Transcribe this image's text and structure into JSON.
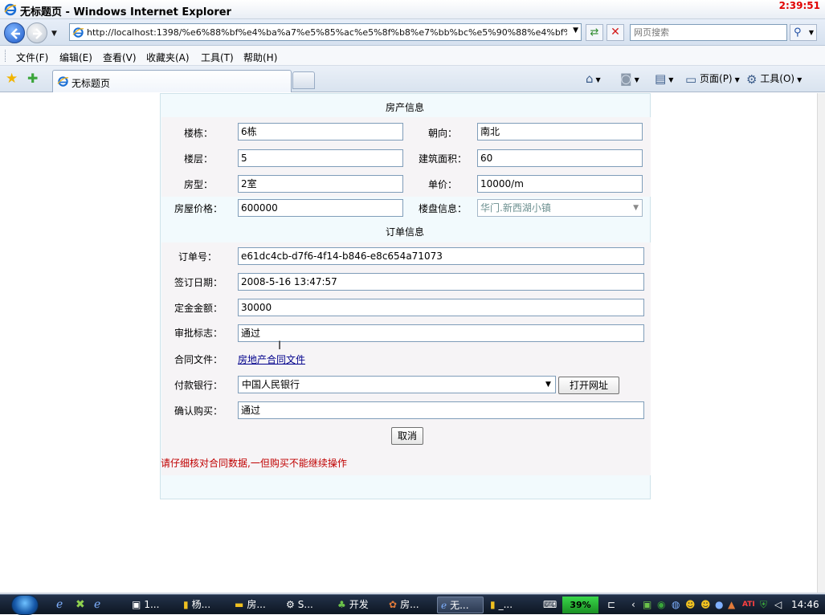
{
  "window": {
    "title": "无标题页 - Windows Internet Explorer",
    "overlay_time": "2:39:51"
  },
  "nav": {
    "address": "http://localhost:1398/%e6%88%bf%e4%ba%a7%e5%85%ac%e5%8f%b8%e7%bb%bc%e5%90%88%e4%bf%a1%e",
    "search_placeholder": "网页搜索"
  },
  "menu": [
    "文件(F)",
    "编辑(E)",
    "查看(V)",
    "收藏夹(A)",
    "工具(T)",
    "帮助(H)"
  ],
  "tab": {
    "label": "无标题页"
  },
  "commands": {
    "page": "页面(P)",
    "tools": "工具(O)"
  },
  "form": {
    "property_section": "房产信息",
    "order_section": "订单信息",
    "building_label": "楼栋：",
    "building_value": "6栋",
    "orientation_label": "朝向：",
    "orientation_value": "南北",
    "floor_label": "楼层：",
    "floor_value": "5",
    "area_label": "建筑面积：",
    "area_value": "60",
    "layout_label": "房型：",
    "layout_value": "2室",
    "unit_price_label": "单价：",
    "unit_price_value": "10000/m",
    "house_price_label": "房屋价格：",
    "house_price_value": "600000",
    "estate_label": "楼盘信息：",
    "estate_value": "华门.新西湖小镇",
    "order_no_label": "订单号：",
    "order_no_value": "e61dc4cb-d7f6-4f14-b846-e8c654a71073",
    "sign_date_label": "签订日期：",
    "sign_date_value": "2008-5-16 13:47:57",
    "deposit_label": "定金金额：",
    "deposit_value": "30000",
    "approval_label": "审批标志：",
    "approval_value": "通过",
    "contract_label": "合同文件：",
    "contract_link": "房地产合同文件",
    "bank_label": "付款银行：",
    "bank_value": "中国人民银行",
    "open_url_button": "打开网址",
    "confirm_label": "确认购买：",
    "confirm_value": "通过",
    "cancel_button": "取消",
    "warning": "请仔细核对合同数据,一但购买不能继续操作"
  },
  "taskbar": {
    "tasks": [
      "1...",
      "杨...",
      "房...",
      "S...",
      "开发",
      "房...",
      "无...",
      "_..."
    ],
    "memory": "39%",
    "clock": "14:46"
  }
}
